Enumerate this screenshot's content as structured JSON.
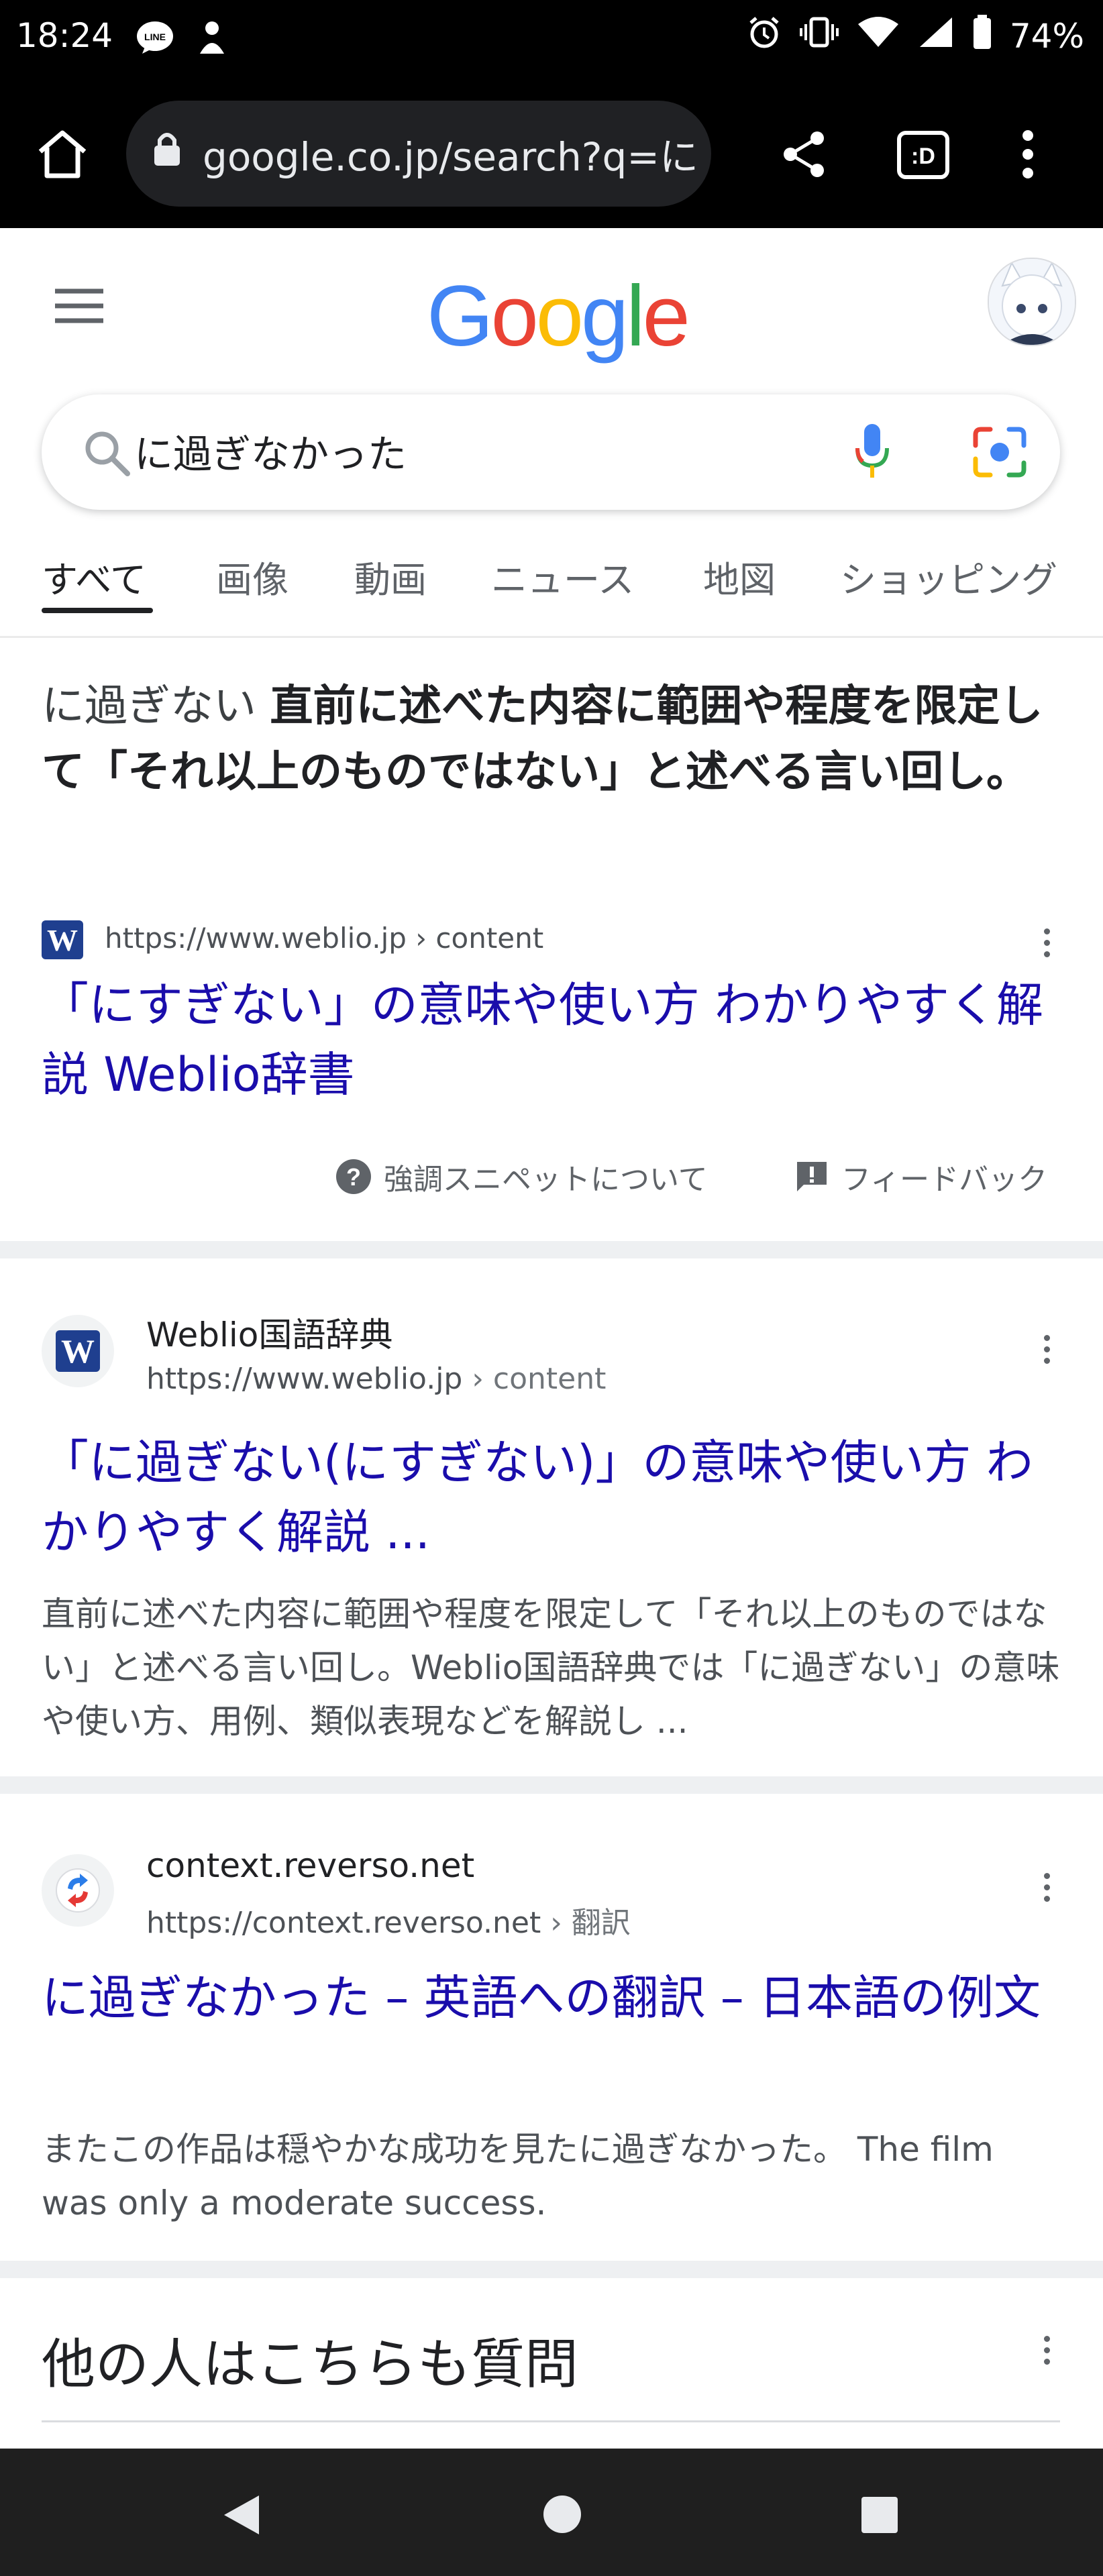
{
  "status_bar": {
    "time": "18:24",
    "battery": "74%"
  },
  "browser": {
    "url": "google.co.jp/search?q=に"
  },
  "google": {
    "logo_text": "Google"
  },
  "search": {
    "query": "に過ぎなかった"
  },
  "tabs": [
    {
      "label": "すべて"
    },
    {
      "label": "画像"
    },
    {
      "label": "動画"
    },
    {
      "label": "ニュース"
    },
    {
      "label": "地図"
    },
    {
      "label": "ショッピング"
    }
  ],
  "featured_snippet": {
    "lead": "に過ぎない ",
    "answer": "直前に述べた内容に範囲や程度を限定して「それ以上のものではない」と述べる言い回し。",
    "source_url": "https://www.weblio.jp › content",
    "title": "「にすぎない」の意味や使い方 わかりやすく解説 Weblio辞書",
    "about_label": "強調スニペットについて",
    "feedback_label": "フィードバック"
  },
  "results": [
    {
      "favicon_letter": "W",
      "site_name": "Weblio国語辞典",
      "url": "https://www.weblio.jp",
      "url_path": " › content",
      "title": "「に過ぎない(にすぎない)」の意味や使い方 わかりやすく解説 ...",
      "snippet": "直前に述べた内容に範囲や程度を限定して「それ以上のものではない」と述べる言い回し。Weblio国語辞典では「に過ぎない」の意味や使い方、用例、類似表現などを解説し ..."
    },
    {
      "site_name": "context.reverso.net",
      "url": "https://context.reverso.net",
      "url_path": " › 翻訳",
      "title": "に過ぎなかった – 英語への翻訳 – 日本語の例文",
      "snippet": "またこの作品は穏やかな成功を見たに過ぎなかった。 The film was only a moderate success."
    }
  ],
  "people_also_ask": {
    "title": "他の人はこちらも質問"
  },
  "colors": {
    "link_blue": "#1a0dab",
    "google_blue": "#4285F4",
    "google_red": "#EA4335",
    "google_yellow": "#FBBC05",
    "google_green": "#34A853"
  }
}
